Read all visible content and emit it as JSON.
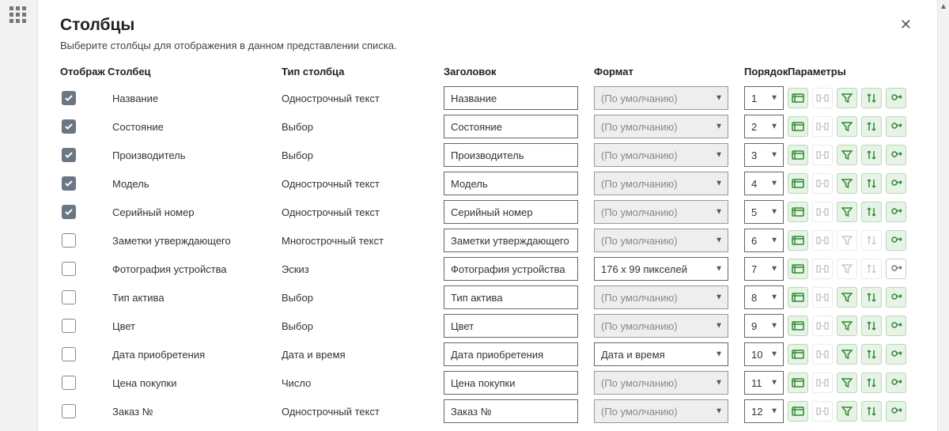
{
  "header": {
    "title": "Столбцы",
    "subtitle": "Выберите столбцы для отображения в данном представлении списка."
  },
  "columns": {
    "display": "Отображ",
    "column": "Столбец",
    "type": "Тип столбца",
    "header": "Заголовок",
    "format": "Формат",
    "order": "Порядок",
    "params": "Параметры"
  },
  "format_default": "(По умолчанию)",
  "rows": [
    {
      "checked": true,
      "name": "Название",
      "type": "Однострочный текст",
      "header": "Название",
      "format": "",
      "format_disabled": true,
      "order": "1",
      "p": [
        true,
        false,
        true,
        true,
        true
      ]
    },
    {
      "checked": true,
      "name": "Состояние",
      "type": "Выбор",
      "header": "Состояние",
      "format": "",
      "format_disabled": true,
      "order": "2",
      "p": [
        true,
        false,
        true,
        true,
        true
      ]
    },
    {
      "checked": true,
      "name": "Производитель",
      "type": "Выбор",
      "header": "Производитель",
      "format": "",
      "format_disabled": true,
      "order": "3",
      "p": [
        true,
        false,
        true,
        true,
        true
      ]
    },
    {
      "checked": true,
      "name": "Модель",
      "type": "Однострочный текст",
      "header": "Модель",
      "format": "",
      "format_disabled": true,
      "order": "4",
      "p": [
        true,
        false,
        true,
        true,
        true
      ]
    },
    {
      "checked": true,
      "name": "Серийный номер",
      "type": "Однострочный текст",
      "header": "Серийный номер",
      "format": "",
      "format_disabled": true,
      "order": "5",
      "p": [
        true,
        false,
        true,
        true,
        true
      ]
    },
    {
      "checked": false,
      "name": "Заметки утверждающего",
      "type": "Многострочный текст",
      "header": "Заметки утверждающего",
      "format": "",
      "format_disabled": true,
      "order": "6",
      "p": [
        true,
        false,
        false,
        false,
        true
      ]
    },
    {
      "checked": false,
      "name": "Фотография устройства",
      "type": "Эскиз",
      "header": "Фотография устройства",
      "format": "176 x 99 пикселей",
      "format_disabled": false,
      "order": "7",
      "p": [
        true,
        false,
        false,
        false,
        false
      ]
    },
    {
      "checked": false,
      "name": "Тип актива",
      "type": "Выбор",
      "header": "Тип актива",
      "format": "",
      "format_disabled": true,
      "order": "8",
      "p": [
        true,
        false,
        true,
        true,
        true
      ]
    },
    {
      "checked": false,
      "name": "Цвет",
      "type": "Выбор",
      "header": "Цвет",
      "format": "",
      "format_disabled": true,
      "order": "9",
      "p": [
        true,
        false,
        true,
        true,
        true
      ]
    },
    {
      "checked": false,
      "name": "Дата приобретения",
      "type": "Дата и время",
      "header": "Дата приобретения",
      "format": "Дата и время",
      "format_disabled": false,
      "order": "10",
      "p": [
        true,
        false,
        true,
        true,
        true
      ]
    },
    {
      "checked": false,
      "name": "Цена покупки",
      "type": "Число",
      "header": "Цена покупки",
      "format": "",
      "format_disabled": true,
      "order": "11",
      "p": [
        true,
        false,
        true,
        true,
        true
      ]
    },
    {
      "checked": false,
      "name": "Заказ №",
      "type": "Однострочный текст",
      "header": "Заказ №",
      "format": "",
      "format_disabled": true,
      "order": "12",
      "p": [
        true,
        false,
        true,
        true,
        true
      ]
    }
  ]
}
